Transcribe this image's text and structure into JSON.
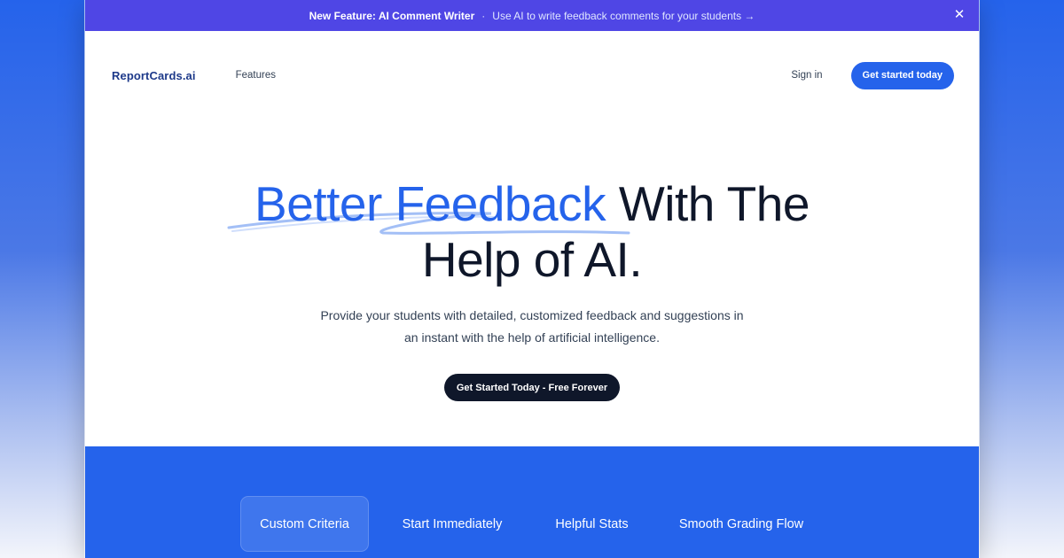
{
  "announcement": {
    "title": "New Feature: AI Comment Writer",
    "separator": "·",
    "link_text": "Use AI to write feedback comments for your students →",
    "close_icon": "close-icon"
  },
  "nav": {
    "logo": "ReportCards.ai",
    "links": [
      {
        "label": "Features"
      }
    ],
    "signin": "Sign in",
    "cta": "Get started today"
  },
  "hero": {
    "headline_highlight": "Better Feedback",
    "headline_rest_1": " With The",
    "headline_line2": "Help of AI.",
    "subtitle_line1": "Provide your students with detailed, customized feedback and suggestions in",
    "subtitle_line2": "an instant with the help of artificial intelligence.",
    "cta": "Get Started Today - Free Forever"
  },
  "features": {
    "tabs": [
      {
        "label": "Custom Criteria",
        "active": true
      },
      {
        "label": "Start Immediately",
        "active": false
      },
      {
        "label": "Helpful Stats",
        "active": false
      },
      {
        "label": "Smooth Grading Flow",
        "active": false
      }
    ]
  },
  "colors": {
    "accent": "#2563eb",
    "announcement_bg": "#4f46e5",
    "dark": "#0f172a",
    "swoosh": "#93b4f5"
  }
}
